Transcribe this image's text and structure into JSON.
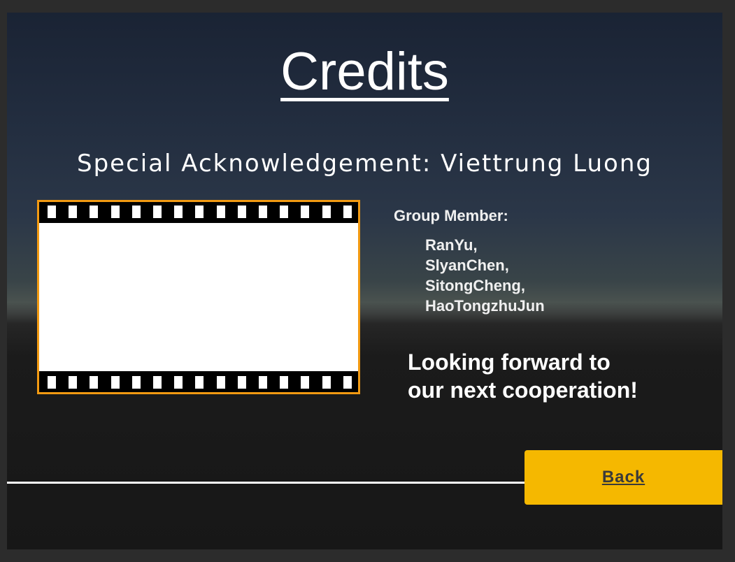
{
  "title": "Credits",
  "acknowledgement": "Special Acknowledgement: Viettrung Luong",
  "group": {
    "heading": "Group Member:",
    "members": [
      "RanYu,",
      "SlyanChen,",
      "SitongCheng,",
      "HaoTongzhuJun"
    ]
  },
  "closing_message": "Looking forward to\nour next cooperation!",
  "back_button_label": "Back",
  "colors": {
    "accent_button": "#f5b800",
    "film_border": "#f29a12"
  }
}
